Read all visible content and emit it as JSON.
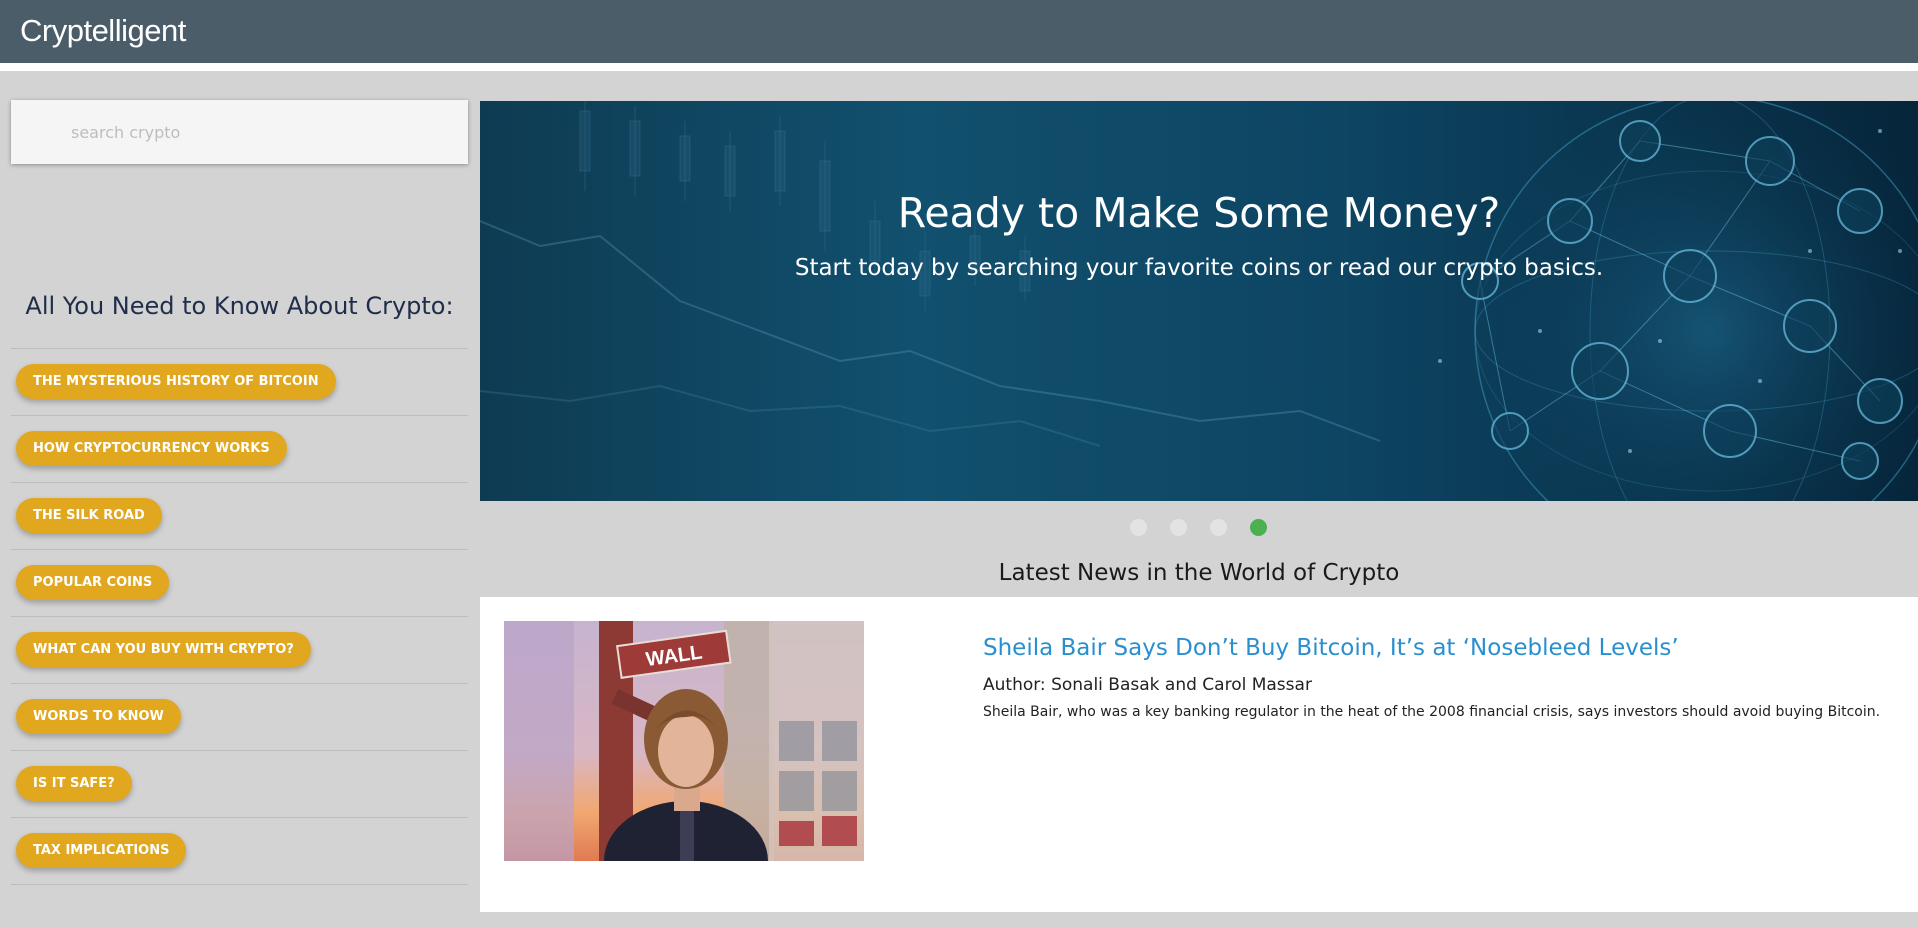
{
  "header": {
    "brand": "Cryptelligent"
  },
  "sidebar": {
    "search_placeholder": "search crypto",
    "heading": "All You Need to Know About Crypto:",
    "items": [
      {
        "label": "THE MYSTERIOUS HISTORY OF BITCOIN"
      },
      {
        "label": "HOW CRYPTOCURRENCY WORKS"
      },
      {
        "label": "THE SILK ROAD"
      },
      {
        "label": "POPULAR COINS"
      },
      {
        "label": "WHAT CAN YOU BUY WITH CRYPTO?"
      },
      {
        "label": "WORDS TO KNOW"
      },
      {
        "label": "IS IT SAFE?"
      },
      {
        "label": "TAX IMPLICATIONS"
      }
    ]
  },
  "hero": {
    "title": "Ready to Make Some Money?",
    "subtitle": "Start today by searching your favorite coins or read our crypto basics.",
    "slide_count": 4,
    "active_slide": 4
  },
  "news": {
    "heading": "Latest News in the World of Crypto",
    "articles": [
      {
        "title": "Sheila Bair Says Don’t Buy Bitcoin, It’s at ‘Nosebleed Levels’",
        "author": "Author: Sonali Basak and Carol Massar",
        "description": "Sheila Bair, who was a key banking regulator in the heat of the 2008 financial crisis, says investors should avoid buying Bitcoin.",
        "image_sign": "WALL"
      }
    ]
  },
  "colors": {
    "topbar": "#4a5d68",
    "pill": "#e0a71f",
    "active_dot": "#4caf50",
    "link": "#2a8fcf"
  }
}
